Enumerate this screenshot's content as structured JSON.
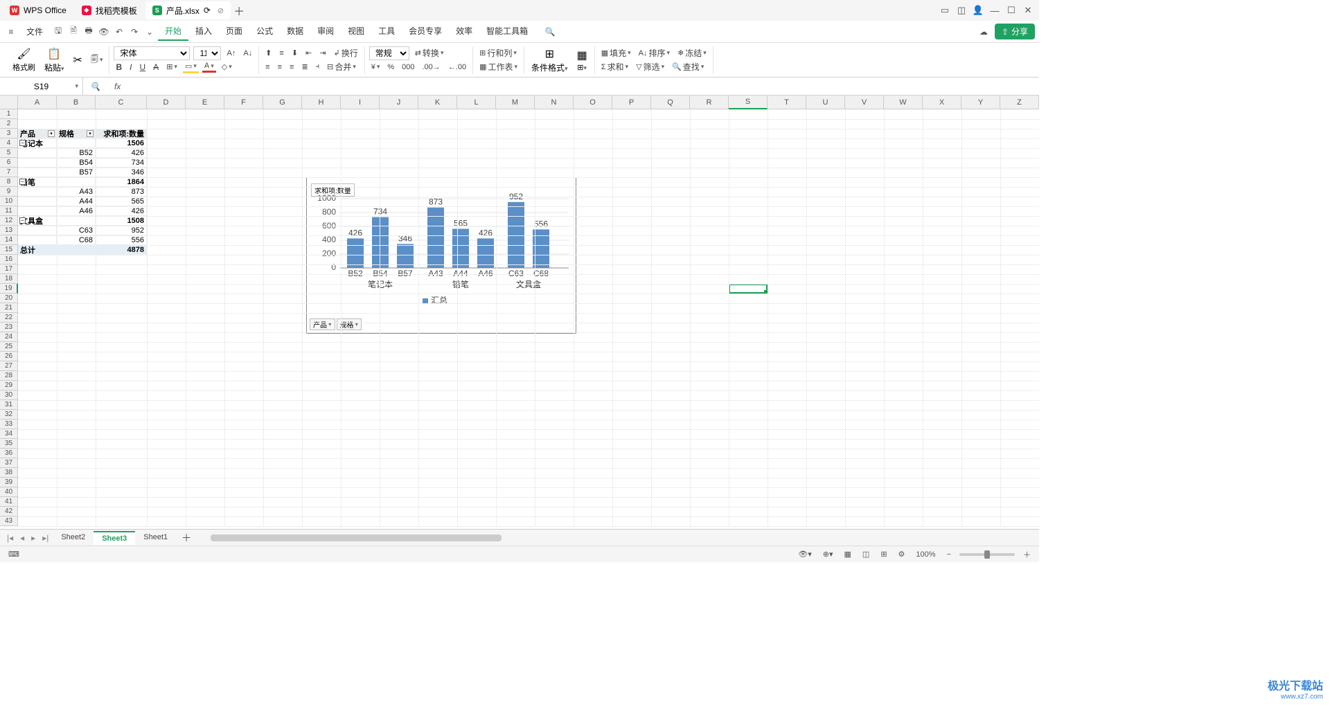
{
  "titlebar": {
    "tabs": [
      {
        "icon_bg": "#d33",
        "icon": "W",
        "label": "WPS Office"
      },
      {
        "icon_bg": "#e14",
        "icon": "❖",
        "label": "找稻壳模板"
      },
      {
        "icon_bg": "#1a9e55",
        "icon": "S",
        "label": "产品.xlsx"
      }
    ],
    "close": "✕"
  },
  "menu": {
    "file": "文件",
    "items": [
      "开始",
      "插入",
      "页面",
      "公式",
      "数据",
      "审阅",
      "视图",
      "工具",
      "会员专享",
      "效率",
      "智能工具箱"
    ],
    "active": "开始",
    "share": "分享"
  },
  "ribbon": {
    "fmtbrush": "格式刷",
    "paste": "粘贴",
    "font": "宋体",
    "size": "11",
    "general": "常规",
    "convert": "转换",
    "rowcol": "行和列",
    "worksheet": "工作表",
    "condfmt": "条件格式",
    "fill": "填充",
    "sort": "排序",
    "freeze": "冻结",
    "sum": "求和",
    "filter": "筛选",
    "find": "查找",
    "merge": "合并",
    "wrap": "换行",
    "tablefmt": "表格样式"
  },
  "namebox": "S19",
  "formula": "fx",
  "columns": [
    "A",
    "B",
    "C",
    "D",
    "E",
    "F",
    "G",
    "H",
    "I",
    "J",
    "K",
    "L",
    "M",
    "N",
    "O",
    "P",
    "Q",
    "R",
    "S",
    "T",
    "U",
    "V",
    "W",
    "X",
    "Y",
    "Z"
  ],
  "selected_col_index": 18,
  "selected_row": 19,
  "row_count": 43,
  "pivot": {
    "headers": {
      "a": "产品",
      "b": "规格",
      "c": "求和项:数量"
    },
    "rows": [
      {
        "a": "笔记本",
        "b": "",
        "c": "1506",
        "bold": true,
        "collapse": true
      },
      {
        "a": "",
        "b": "B52",
        "c": "426"
      },
      {
        "a": "",
        "b": "B54",
        "c": "734"
      },
      {
        "a": "",
        "b": "B57",
        "c": "346"
      },
      {
        "a": "铅笔",
        "b": "",
        "c": "1864",
        "bold": true,
        "collapse": true
      },
      {
        "a": "",
        "b": "A43",
        "c": "873"
      },
      {
        "a": "",
        "b": "A44",
        "c": "565"
      },
      {
        "a": "",
        "b": "A46",
        "c": "426"
      },
      {
        "a": "文具盒",
        "b": "",
        "c": "1508",
        "bold": true,
        "collapse": true
      },
      {
        "a": "",
        "b": "C63",
        "c": "952"
      },
      {
        "a": "",
        "b": "C68",
        "c": "556"
      },
      {
        "a": "总计",
        "b": "",
        "c": "4878",
        "bold": true,
        "highlight": true
      }
    ]
  },
  "chart_data": {
    "type": "bar",
    "title": "求和项:数量",
    "legend": "汇总",
    "ylim": [
      0,
      1000
    ],
    "yticks": [
      0,
      200,
      400,
      600,
      800,
      1000
    ],
    "groups": [
      {
        "name": "笔记本",
        "bars": [
          {
            "label": "B52",
            "value": 426
          },
          {
            "label": "B54",
            "value": 734
          },
          {
            "label": "B57",
            "value": 346
          }
        ]
      },
      {
        "name": "铅笔",
        "bars": [
          {
            "label": "A43",
            "value": 873
          },
          {
            "label": "A44",
            "value": 565
          },
          {
            "label": "A46",
            "value": 426
          }
        ]
      },
      {
        "name": "文具盒",
        "bars": [
          {
            "label": "C63",
            "value": 952
          },
          {
            "label": "C68",
            "value": 556
          }
        ]
      }
    ],
    "filters": [
      "产品",
      "规格"
    ]
  },
  "sheets": {
    "tabs": [
      "Sheet2",
      "Sheet3",
      "Sheet1"
    ],
    "active": "Sheet3"
  },
  "statusbar": {
    "zoom": "100%"
  },
  "watermark": {
    "l1": "极光下载站",
    "l2": "www.xz7.com"
  }
}
